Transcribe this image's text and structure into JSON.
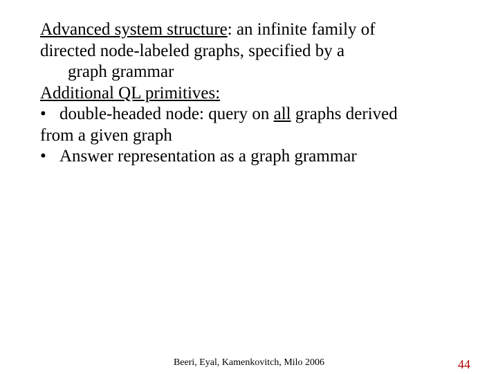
{
  "content": {
    "line1_u": "Advanced  system structure",
    "line1_rest": ":  an infinite family of",
    "line2": "directed node-labeled graphs,   specified  by a",
    "line3": "graph grammar",
    "line4_u": "Additional QL primitives:",
    "bullet1_a": " double-headed node: query on ",
    "bullet1_u": "all",
    "bullet1_b": " graphs derived",
    "bullet1_c": "from a given graph",
    "bullet2": "Answer representation as a graph grammar",
    "bullet_char": "•"
  },
  "footer": {
    "center": "Beeri, Eyal, Kamenkovitch, Milo  2006",
    "page": "44"
  }
}
